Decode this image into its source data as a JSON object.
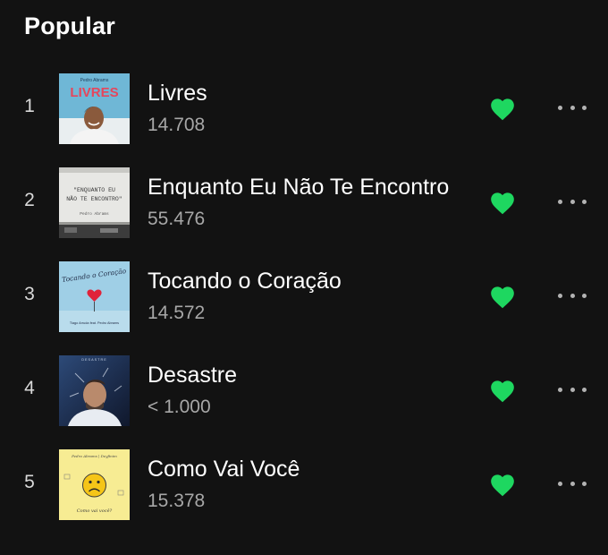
{
  "section": {
    "title": "Popular"
  },
  "colors": {
    "accent": "#1ed760",
    "background": "#121212",
    "secondary_text": "#a7a7a7"
  },
  "tracks": [
    {
      "number": "1",
      "title": "Livres",
      "plays": "14.708",
      "liked": true,
      "cover": {
        "artist": "Pedro Abrams",
        "title": "LIVRES"
      }
    },
    {
      "number": "2",
      "title": "Enquanto Eu Não Te Encontro",
      "plays": "55.476",
      "liked": true,
      "cover": {
        "line1": "\"ENQUANTO EU",
        "line2": "NÃO TE ENCONTRO\"",
        "artist": "Pedro Abrams"
      }
    },
    {
      "number": "3",
      "title": "Tocando o Coração",
      "plays": "14.572",
      "liked": true,
      "cover": {
        "title": "Tocando o Coração",
        "artist": "Tiago Arruda feat. Pedro Abrams"
      }
    },
    {
      "number": "4",
      "title": "Desastre",
      "plays": "< 1.000",
      "liked": true,
      "cover": {
        "title": "DESASTRE"
      }
    },
    {
      "number": "5",
      "title": "Como Vai Você",
      "plays": "15.378",
      "liked": true,
      "cover": {
        "header": "Pedro Abrams | Deyfinim",
        "footer": "Como vai você?"
      }
    }
  ],
  "icons": {
    "like": "heart-filled-icon",
    "more": "more-horizontal-icon",
    "emoji": "sad-face-icon"
  }
}
